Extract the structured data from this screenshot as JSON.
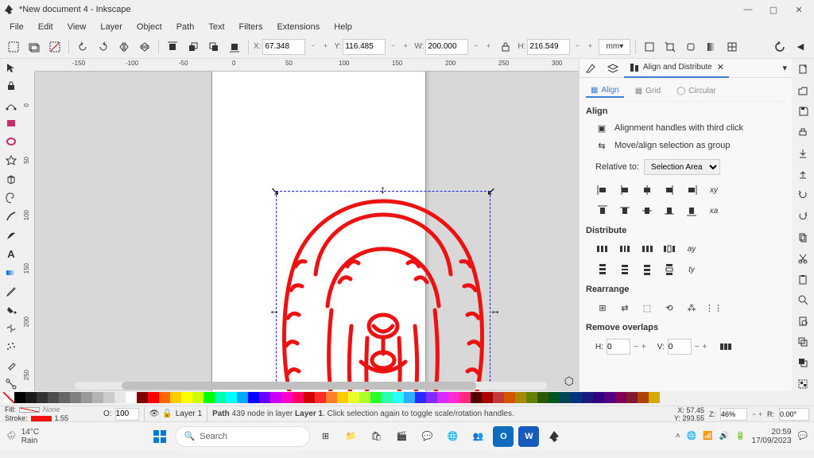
{
  "window": {
    "title": "*New document 4 - Inkscape"
  },
  "menu": [
    "File",
    "Edit",
    "View",
    "Layer",
    "Object",
    "Path",
    "Text",
    "Filters",
    "Extensions",
    "Help"
  ],
  "coords": {
    "x_label": "X:",
    "x": "67.348",
    "y_label": "Y:",
    "y": "116.485",
    "w_label": "W:",
    "w": "200.000",
    "h_label": "H:",
    "h": "216.549",
    "unit": "mm"
  },
  "ruler_h": [
    {
      "pos": 47,
      "v": "-150"
    },
    {
      "pos": 114,
      "v": "-100"
    },
    {
      "pos": 181,
      "v": "-50"
    },
    {
      "pos": 248,
      "v": "0"
    },
    {
      "pos": 315,
      "v": "50"
    },
    {
      "pos": 382,
      "v": "100"
    },
    {
      "pos": 449,
      "v": "150"
    },
    {
      "pos": 516,
      "v": "200"
    },
    {
      "pos": 583,
      "v": "250"
    },
    {
      "pos": 650,
      "v": "300"
    }
  ],
  "ruler_v": [
    {
      "pos": 40,
      "v": "0"
    },
    {
      "pos": 107,
      "v": "50"
    },
    {
      "pos": 174,
      "v": "100"
    },
    {
      "pos": 241,
      "v": "150"
    },
    {
      "pos": 308,
      "v": "200"
    },
    {
      "pos": 375,
      "v": "250"
    }
  ],
  "panel": {
    "tab_title": "Align and Distribute",
    "subtabs": {
      "align": "Align",
      "grid": "Grid",
      "circular": "Circular"
    },
    "section_align": "Align",
    "opt_thirdclick": "Alignment handles with third click",
    "opt_group": "Move/align selection as group",
    "relative_label": "Relative to:",
    "relative_value": "Selection Area",
    "section_distribute": "Distribute",
    "section_rearrange": "Rearrange",
    "section_remove": "Remove overlaps",
    "overlap_h_label": "H:",
    "overlap_h": "0",
    "overlap_v_label": "V:",
    "overlap_v": "0"
  },
  "status": {
    "fill_label": "Fill:",
    "fill_value": "None",
    "stroke_label": "Stroke:",
    "stroke_value": "1.55",
    "opacity_label": "O:",
    "opacity": "100",
    "layer": "Layer 1",
    "message": "Path 439 node in layer Layer 1. Click selection again to toggle scale/rotation handles.",
    "pointer_x_label": "X:",
    "pointer_x": "57.45",
    "pointer_y_label": "Y:",
    "pointer_y": "293.55",
    "zoom_label": "Z:",
    "zoom": "46%",
    "rotate_label": "R:",
    "rotate": "0.00°"
  },
  "palette_colors": [
    "nocol",
    "#000",
    "#1a1a1a",
    "#333",
    "#4d4d4d",
    "#666",
    "#808080",
    "#999",
    "#b3b3b3",
    "#ccc",
    "#e6e6e6",
    "#fff",
    "#800000",
    "#f00",
    "#ff6600",
    "#ffcc00",
    "#ff0",
    "#cf0",
    "#0f0",
    "#0fa",
    "#0ff",
    "#0af",
    "#00f",
    "#60f",
    "#c0f",
    "#f0c",
    "#f06",
    "#d40000",
    "#ff2a2a",
    "#ff7f2a",
    "#fc0",
    "#e9ff2a",
    "#afff2a",
    "#2aff2a",
    "#2affb0",
    "#2affff",
    "#2ab0ff",
    "#2a2aff",
    "#7f2aff",
    "#d42aff",
    "#ff2ad4",
    "#ff2a7f",
    "#550000",
    "#a00",
    "#c83737",
    "#d45500",
    "#aa8800",
    "#668000",
    "#2c5a00",
    "#005522",
    "#004455",
    "#003380",
    "#1a1a80",
    "#330080",
    "#550080",
    "#800055",
    "#801a2c",
    "#aa4400",
    "#d4aa00"
  ],
  "taskbar": {
    "temp": "14°C",
    "cond": "Rain",
    "search_placeholder": "Search",
    "time": "20:59",
    "date": "17/09/2023"
  }
}
